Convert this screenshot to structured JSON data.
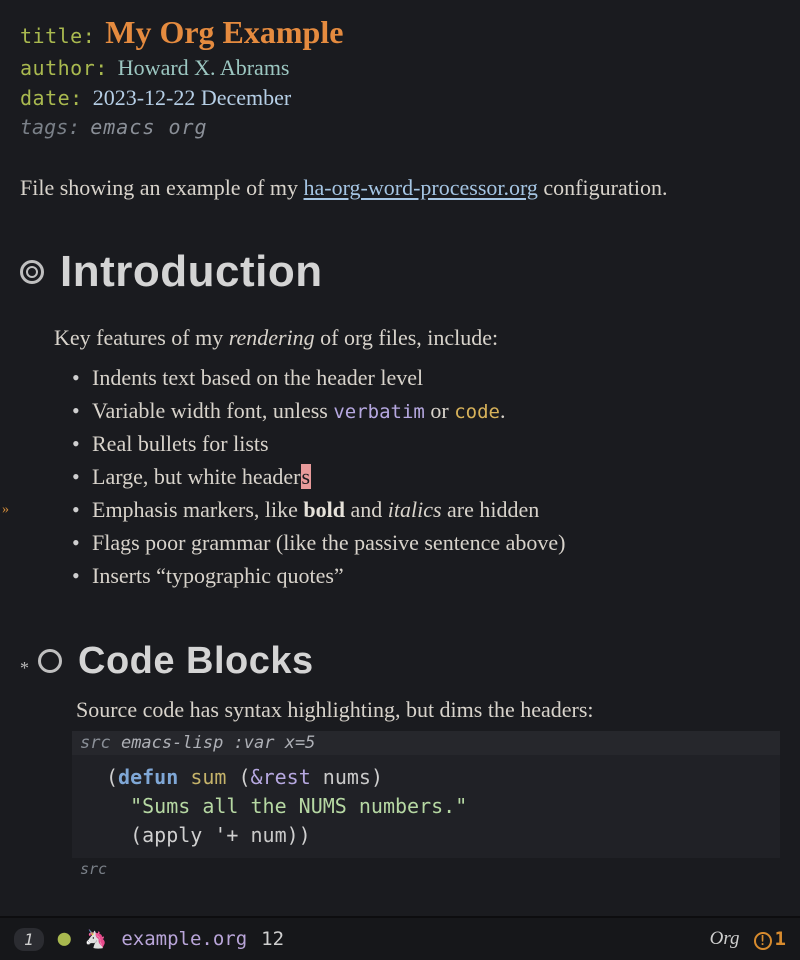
{
  "meta": {
    "title_key": "title:",
    "title_val": "My Org Example",
    "author_key": "author:",
    "author_val": "Howard X. Abrams",
    "date_key": "date:",
    "date_val": "2023-12-22 December",
    "tags_key": "tags:",
    "tags_val": "emacs org"
  },
  "intro_para_pre": "File showing an example of my ",
  "intro_link": "ha-org-word-processor.org",
  "intro_para_post": " configuration.",
  "h1": "Introduction",
  "intro_line_pre": "Key features of my ",
  "intro_line_em": "rendering",
  "intro_line_post": " of org files, include:",
  "bullets": {
    "b0": "Indents text based on the header level",
    "b1_pre": "Variable width font, unless ",
    "b1_v": "verbatim",
    "b1_mid": " or ",
    "b1_c": "code",
    "b1_post": ".",
    "b2": "Real bullets for lists",
    "b3_pre": "Large, but white header",
    "b3_cur": "s",
    "b4_pre": "Emphasis markers, like ",
    "b4_bold": "bold",
    "b4_mid": " and ",
    "b4_italics": "italics",
    "b4_post": " are hidden",
    "b5": "Flags poor grammar (like the passive sentence above)",
    "b6": "Inserts “typographic quotes”"
  },
  "h2": "Code Blocks",
  "src_intro": "Source code has syntax highlighting, but dims the headers:",
  "src_begin_label": "src",
  "src_lang": " emacs-lisp :var x=5",
  "code": {
    "l1_open": "(",
    "l1_defun": "defun",
    "l1_sp1": " ",
    "l1_name": "sum",
    "l1_sp2": " ",
    "l1_po": "(",
    "l1_amp": "&rest",
    "l1_sp3": " ",
    "l1_arg": "nums",
    "l1_pc": ")",
    "l2_str": "\"Sums all the NUMS numbers.\"",
    "l3_open": "(",
    "l3_apply": "apply ",
    "l3_quote": "'+ ",
    "l3_arg": "num",
    "l3_close": "))"
  },
  "src_end_label": "src",
  "modeline": {
    "window_no": "1",
    "modified_icon": "●",
    "unicorn": " 🦄",
    "filename": "example.org",
    "line": "12",
    "mode": "Org",
    "warn_count": "1"
  }
}
